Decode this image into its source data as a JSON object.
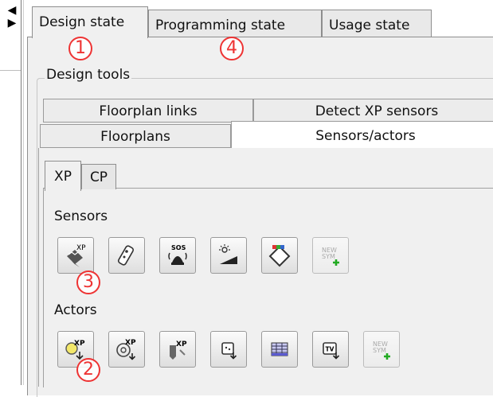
{
  "window": {
    "top_tabs": [
      {
        "label": "Design state",
        "active": true
      },
      {
        "label": "Programming state",
        "active": false
      },
      {
        "label": "Usage state",
        "active": false
      }
    ]
  },
  "design_tools": {
    "group_title": "Design tools",
    "tabs_row_back": [
      "Floorplan links",
      "Detect XP sensors"
    ],
    "tabs_row_front": [
      "Floorplans",
      "Sensors/actors"
    ],
    "active_tab": "Sensors/actors",
    "inner_tabs": [
      "XP",
      "CP"
    ],
    "active_inner_tab": "XP"
  },
  "sensors": {
    "title": "Sensors",
    "tools": [
      "xp-sensor-icon",
      "remote-sensor-icon",
      "sos-alarm-icon",
      "light-sensor-icon",
      "diamond-sensor-icon",
      "new-symbol-icon"
    ],
    "tool_labels": {
      "sos": "SOS",
      "xp": "XP",
      "new": "NEW",
      "sym": "SYM"
    }
  },
  "actors": {
    "title": "Actors",
    "tools": [
      "xp-lamp-actor-icon",
      "xp-dimmer-actor-icon",
      "xp-valve-actor-icon",
      "socket-actor-icon",
      "blinds-actor-icon",
      "tv-actor-icon",
      "new-symbol-icon"
    ],
    "tool_labels": {
      "xp": "XP",
      "tv": "TV",
      "new": "NEW",
      "sym": "SYM"
    }
  },
  "callouts": [
    "1",
    "2",
    "3",
    "4"
  ],
  "colors": {
    "callout": "#e33333",
    "panel": "#f0f0f0",
    "active_tab": "#ffffff"
  }
}
